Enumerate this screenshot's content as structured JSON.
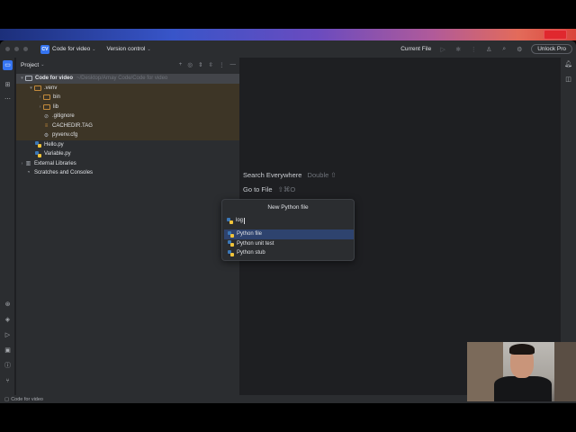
{
  "titlebar": {
    "project_badge": "CV",
    "project_name": "Code for video",
    "vcs_label": "Version control",
    "run_config": "Current File",
    "unlock_label": "Unlock Pro"
  },
  "project_panel": {
    "title": "Project",
    "tree": [
      {
        "label": "Code for video",
        "path": "~/Desktop/Arnay Code/Code for video",
        "depth": 0,
        "type": "folder",
        "expanded": true,
        "selected": true
      },
      {
        "label": ".venv",
        "depth": 1,
        "type": "folder-orange",
        "expanded": true
      },
      {
        "label": "bin",
        "depth": 2,
        "type": "folder-orange",
        "expanded": false
      },
      {
        "label": "lib",
        "depth": 2,
        "type": "folder-orange",
        "expanded": false
      },
      {
        "label": ".gitignore",
        "depth": 2,
        "type": "ignore"
      },
      {
        "label": "CACHEDIR.TAG",
        "depth": 2,
        "type": "tag"
      },
      {
        "label": "pyvenv.cfg",
        "depth": 2,
        "type": "cfg"
      },
      {
        "label": "Hello.py",
        "depth": 1,
        "type": "python"
      },
      {
        "label": "Variable.py",
        "depth": 1,
        "type": "python"
      },
      {
        "label": "External Libraries",
        "depth": 0,
        "type": "libs",
        "expanded": false
      },
      {
        "label": "Scratches and Consoles",
        "depth": 0,
        "type": "scratch"
      }
    ]
  },
  "editor_hints": [
    {
      "label": "Search Everywhere",
      "shortcut": "Double ⇧"
    },
    {
      "label": "Go to File",
      "shortcut": "⇧⌘O"
    }
  ],
  "new_file_dialog": {
    "title": "New Python file",
    "input_value": "log",
    "options": [
      {
        "label": "Python file",
        "selected": true
      },
      {
        "label": "Python unit test",
        "selected": false
      },
      {
        "label": "Python stub",
        "selected": false
      }
    ]
  },
  "statusbar": {
    "breadcrumb": "Code for video"
  },
  "colors": {
    "accent": "#3574f0",
    "background": "#1e1f22",
    "panel": "#2b2d30",
    "selection": "#2e436e",
    "venv_highlight": "#3d3526"
  }
}
